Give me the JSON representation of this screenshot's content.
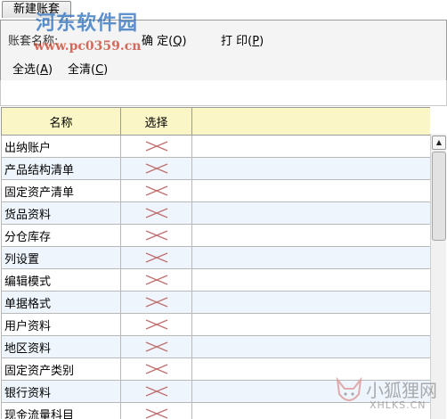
{
  "tab": {
    "label": "新建账套"
  },
  "toolbar": {
    "name_label": "账套名称:",
    "confirm": {
      "text": "确 定(",
      "key": "Q",
      "close": ")"
    },
    "print": {
      "text": "打 印(",
      "key": "P",
      "close": ")"
    },
    "select_all": {
      "text": "全选(",
      "key": "A",
      "close": ")"
    },
    "clear_all": {
      "text": "全清(",
      "key": "C",
      "close": ")"
    }
  },
  "table": {
    "headers": [
      "名称",
      "选择",
      ""
    ],
    "rows": [
      "出纳账户",
      "产品结构清单",
      "固定资产清单",
      "货品资料",
      "分仓库存",
      "列设置",
      "编辑模式",
      "单据格式",
      "用户资料",
      "地区资料",
      "固定资产类别",
      "银行资料",
      "现金流量科目"
    ]
  },
  "scrollbar": {
    "up_arrow": "▲"
  },
  "watermarks": {
    "site_cn": "河东软件园",
    "site_url": "www.pc0359.cn",
    "fox_cn": "小狐狸网",
    "fox_en": "XHLKS.CN"
  }
}
